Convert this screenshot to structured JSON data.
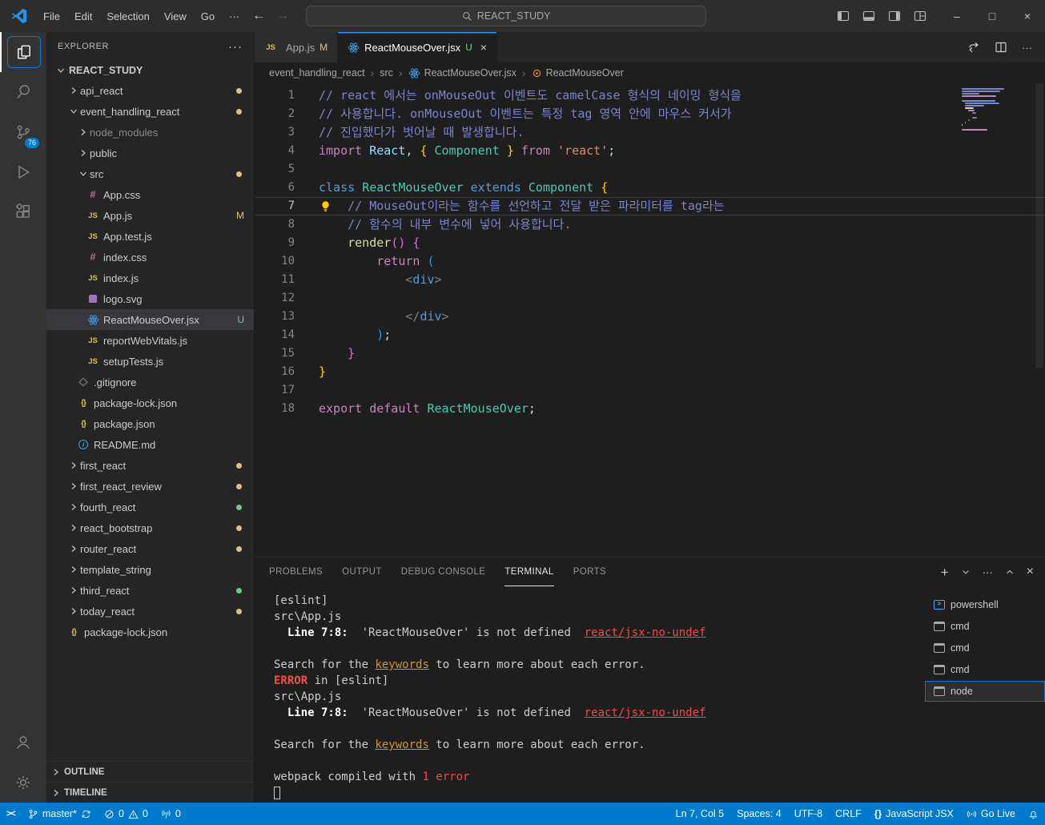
{
  "titlebar": {
    "menus": [
      "File",
      "Edit",
      "Selection",
      "View",
      "Go"
    ],
    "more_label": "···",
    "search_placeholder": "REACT_STUDY"
  },
  "activitybar": {
    "scm_badge": "76"
  },
  "sidebar": {
    "title": "EXPLORER",
    "root_label": "REACT_STUDY",
    "outline_label": "OUTLINE",
    "timeline_label": "TIMELINE",
    "tree": [
      {
        "label": "api_react",
        "level": 0,
        "arrow": "r",
        "dot": "mod"
      },
      {
        "label": "event_handling_react",
        "level": 0,
        "arrow": "d",
        "dot": "mod"
      },
      {
        "label": "node_modules",
        "level": 1,
        "arrow": "r",
        "dim": true
      },
      {
        "label": "public",
        "level": 1,
        "arrow": "r"
      },
      {
        "label": "src",
        "level": 1,
        "arrow": "d",
        "dot": "mod"
      },
      {
        "label": "App.css",
        "level": 2,
        "icon": "css"
      },
      {
        "label": "App.js",
        "level": 2,
        "icon": "js",
        "badge": "M"
      },
      {
        "label": "App.test.js",
        "level": 2,
        "icon": "js"
      },
      {
        "label": "index.css",
        "level": 2,
        "icon": "css"
      },
      {
        "label": "index.js",
        "level": 2,
        "icon": "js"
      },
      {
        "label": "logo.svg",
        "level": 2,
        "icon": "svg"
      },
      {
        "label": "ReactMouseOver.jsx",
        "level": 2,
        "icon": "react",
        "badge": "U",
        "selected": true
      },
      {
        "label": "reportWebVitals.js",
        "level": 2,
        "icon": "js"
      },
      {
        "label": "setupTests.js",
        "level": 2,
        "icon": "js"
      },
      {
        "label": ".gitignore",
        "level": 1,
        "icon": "git"
      },
      {
        "label": "package-lock.json",
        "level": 1,
        "icon": "json"
      },
      {
        "label": "package.json",
        "level": 1,
        "icon": "json"
      },
      {
        "label": "README.md",
        "level": 1,
        "icon": "md"
      },
      {
        "label": "first_react",
        "level": 0,
        "arrow": "r",
        "dot": "mod"
      },
      {
        "label": "first_react_review",
        "level": 0,
        "arrow": "r",
        "dot": "mod"
      },
      {
        "label": "fourth_react",
        "level": 0,
        "arrow": "r",
        "dot": "green"
      },
      {
        "label": "react_bootstrap",
        "level": 0,
        "arrow": "r",
        "dot": "mod"
      },
      {
        "label": "router_react",
        "level": 0,
        "arrow": "r",
        "dot": "mod"
      },
      {
        "label": "template_string",
        "level": 0,
        "arrow": "r"
      },
      {
        "label": "third_react",
        "level": 0,
        "arrow": "r",
        "dot": "green"
      },
      {
        "label": "today_react",
        "level": 0,
        "arrow": "r",
        "dot": "mod"
      },
      {
        "label": "package-lock.json",
        "level": 0,
        "icon": "json"
      }
    ]
  },
  "editor_tabs": [
    {
      "label": "App.js",
      "badge": "M",
      "icon": "js"
    },
    {
      "label": "ReactMouseOver.jsx",
      "badge": "U",
      "icon": "react"
    }
  ],
  "breadcrumbs": [
    {
      "label": "event_handling_react"
    },
    {
      "label": "src"
    },
    {
      "label": "ReactMouseOver.jsx",
      "icon": "react"
    },
    {
      "label": "ReactMouseOver",
      "icon": "class"
    }
  ],
  "editor": {
    "lines": [
      {
        "n": 1,
        "tokens": [
          {
            "c": "c",
            "t": "// react 에서는 onMouseOut 이벤트도 camelCase 형식의 네이밍 형식을"
          }
        ]
      },
      {
        "n": 2,
        "tokens": [
          {
            "c": "c",
            "t": "// 사용합니다. onMouseOut 이벤트는 특정 tag 영역 안에 마우스 커서가"
          }
        ]
      },
      {
        "n": 3,
        "tokens": [
          {
            "c": "c",
            "t": "// 진입했다가 벗어날 때 발생합니다."
          }
        ]
      },
      {
        "n": 4,
        "tokens": [
          {
            "c": "k",
            "t": "import"
          },
          {
            "c": "p",
            "t": " "
          },
          {
            "c": "v",
            "t": "React"
          },
          {
            "c": "p",
            "t": ", "
          },
          {
            "c": "b1",
            "t": "{"
          },
          {
            "c": "p",
            "t": " "
          },
          {
            "c": "cl",
            "t": "Component"
          },
          {
            "c": "p",
            "t": " "
          },
          {
            "c": "b1",
            "t": "}"
          },
          {
            "c": "p",
            "t": " "
          },
          {
            "c": "k",
            "t": "from"
          },
          {
            "c": "p",
            "t": " "
          },
          {
            "c": "s",
            "t": "'react'"
          },
          {
            "c": "p",
            "t": ";"
          }
        ]
      },
      {
        "n": 5,
        "tokens": []
      },
      {
        "n": 6,
        "tokens": [
          {
            "c": "kb",
            "t": "class"
          },
          {
            "c": "p",
            "t": " "
          },
          {
            "c": "cl",
            "t": "ReactMouseOver"
          },
          {
            "c": "p",
            "t": " "
          },
          {
            "c": "kb",
            "t": "extends"
          },
          {
            "c": "p",
            "t": " "
          },
          {
            "c": "cl",
            "t": "Component"
          },
          {
            "c": "p",
            "t": " "
          },
          {
            "c": "b1",
            "t": "{"
          }
        ]
      },
      {
        "n": 7,
        "current": true,
        "bulb": true,
        "tokens": [
          {
            "c": "c",
            "t": "    // MouseOut이라는 함수를 선언하고 전달 받은 파라미터를 tag라는"
          }
        ]
      },
      {
        "n": 8,
        "tokens": [
          {
            "c": "c",
            "t": "    // 함수의 내부 변수에 넣어 사용합니다."
          }
        ]
      },
      {
        "n": 9,
        "tokens": [
          {
            "c": "p",
            "t": "    "
          },
          {
            "c": "fn",
            "t": "render"
          },
          {
            "c": "b2",
            "t": "()"
          },
          {
            "c": "p",
            "t": " "
          },
          {
            "c": "b2",
            "t": "{"
          }
        ]
      },
      {
        "n": 10,
        "tokens": [
          {
            "c": "p",
            "t": "        "
          },
          {
            "c": "k",
            "t": "return"
          },
          {
            "c": "p",
            "t": " "
          },
          {
            "c": "b3",
            "t": "("
          }
        ]
      },
      {
        "n": 11,
        "tokens": [
          {
            "c": "p",
            "t": "            "
          },
          {
            "c": "ab",
            "t": "<"
          },
          {
            "c": "tg",
            "t": "div"
          },
          {
            "c": "ab",
            "t": ">"
          }
        ]
      },
      {
        "n": 12,
        "tokens": []
      },
      {
        "n": 13,
        "tokens": [
          {
            "c": "p",
            "t": "            "
          },
          {
            "c": "ab",
            "t": "</"
          },
          {
            "c": "tg",
            "t": "div"
          },
          {
            "c": "ab",
            "t": ">"
          }
        ]
      },
      {
        "n": 14,
        "tokens": [
          {
            "c": "p",
            "t": "        "
          },
          {
            "c": "b3",
            "t": ")"
          },
          {
            "c": "p",
            "t": ";"
          }
        ]
      },
      {
        "n": 15,
        "tokens": [
          {
            "c": "p",
            "t": "    "
          },
          {
            "c": "b2",
            "t": "}"
          }
        ]
      },
      {
        "n": 16,
        "tokens": [
          {
            "c": "b1",
            "t": "}"
          }
        ]
      },
      {
        "n": 17,
        "tokens": []
      },
      {
        "n": 18,
        "tokens": [
          {
            "c": "k",
            "t": "export"
          },
          {
            "c": "p",
            "t": " "
          },
          {
            "c": "k",
            "t": "default"
          },
          {
            "c": "p",
            "t": " "
          },
          {
            "c": "cl",
            "t": "ReactMouseOver"
          },
          {
            "c": "p",
            "t": ";"
          }
        ]
      }
    ]
  },
  "panel": {
    "tabs": [
      "PROBLEMS",
      "OUTPUT",
      "DEBUG CONSOLE",
      "TERMINAL",
      "PORTS"
    ],
    "active_tab": "TERMINAL",
    "terminal_lines": [
      [
        {
          "c": "d",
          "t": "[eslint]"
        }
      ],
      [
        {
          "c": "d",
          "t": "src\\App.js"
        }
      ],
      [
        {
          "c": "d",
          "t": "  "
        },
        {
          "c": "b",
          "t": "Line 7:8:"
        },
        {
          "c": "d",
          "t": "  'ReactMouseOver' is not defined  "
        },
        {
          "c": "rl",
          "t": "react/jsx-no-undef"
        }
      ],
      [],
      [
        {
          "c": "d",
          "t": "Search for the "
        },
        {
          "c": "yl",
          "t": "keywords"
        },
        {
          "c": "d",
          "t": " to learn more about each error."
        }
      ],
      [
        {
          "c": "rb",
          "t": "ERROR"
        },
        {
          "c": "d",
          "t": " in [eslint]"
        }
      ],
      [
        {
          "c": "d",
          "t": "src\\App.js"
        }
      ],
      [
        {
          "c": "d",
          "t": "  "
        },
        {
          "c": "b",
          "t": "Line 7:8:"
        },
        {
          "c": "d",
          "t": "  'ReactMouseOver' is not defined  "
        },
        {
          "c": "rl",
          "t": "react/jsx-no-undef"
        }
      ],
      [],
      [
        {
          "c": "d",
          "t": "Search for the "
        },
        {
          "c": "yl",
          "t": "keywords"
        },
        {
          "c": "d",
          "t": " to learn more about each error."
        }
      ],
      [],
      [
        {
          "c": "d",
          "t": "webpack compiled with "
        },
        {
          "c": "r",
          "t": "1 error"
        }
      ],
      [
        {
          "c": "cur",
          "t": " "
        }
      ]
    ],
    "terminals": [
      {
        "label": "powershell",
        "icon": "powershell"
      },
      {
        "label": "cmd",
        "icon": "cmd"
      },
      {
        "label": "cmd",
        "icon": "cmd"
      },
      {
        "label": "cmd",
        "icon": "cmd"
      },
      {
        "label": "node",
        "icon": "node",
        "selected": true
      }
    ]
  },
  "statusbar": {
    "branch": "master*",
    "errors": "0",
    "warnings": "0",
    "ports": "0",
    "line_col": "Ln 7, Col 5",
    "spaces": "Spaces: 4",
    "encoding": "UTF-8",
    "eol": "CRLF",
    "language": "JavaScript JSX",
    "live": "Go Live"
  },
  "colors": {
    "accent": "#007acc",
    "git_modified": "#e2c08d",
    "git_untracked": "#73c991",
    "error": "#f14c4c"
  }
}
